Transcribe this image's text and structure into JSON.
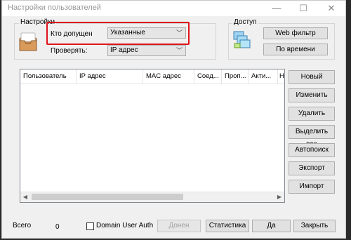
{
  "window": {
    "title": "Настройки пользователей",
    "minimize_glyph": "—",
    "maximize_glyph": "☐",
    "close_glyph": "✕"
  },
  "settings": {
    "group_label": "Настройки",
    "who_label": "Кто допущен",
    "who_value": "Указанные",
    "check_label": "Проверять:",
    "check_value": "IP адрес"
  },
  "access": {
    "group_label": "Доступ",
    "web_filter": "Web фильтр",
    "by_time": "По времени"
  },
  "table": {
    "columns": [
      "Пользователь",
      "IP адрес",
      "MAC адрес",
      "Соед...",
      "Проп...",
      "Акти...",
      "Н"
    ],
    "rows": []
  },
  "side_buttons": [
    "Новый",
    "Изменить",
    "Удалить",
    "Выделить все",
    "Автопоиск",
    "Экспорт",
    "Импорт"
  ],
  "footer": {
    "total_label": "Всего",
    "total_value": "0",
    "domain_auth_label": "Domain User Auth",
    "cancel": "Донен",
    "stats": "Статистика",
    "yes": "Да",
    "close": "Закрыть"
  },
  "colors": {
    "highlight": "#e0131b"
  },
  "icons": [
    "users-box-icon",
    "computers-icon",
    "chevron-down-icon",
    "arrow-left-icon",
    "arrow-right-icon"
  ]
}
